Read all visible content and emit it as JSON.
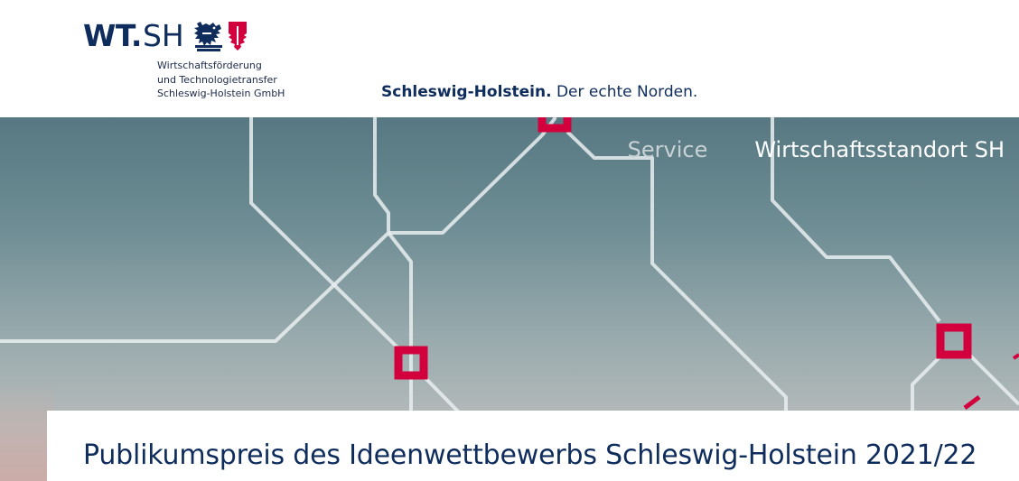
{
  "logo": {
    "wt": "WT.",
    "sh": "SH",
    "lion_icon": "lion-coat-of-arms-icon",
    "nettle_icon": "nettle-leaf-icon",
    "subtitle_lines": [
      "Wirtschaftsförderung",
      "und Technologietransfer",
      "Schleswig-Holstein GmbH"
    ]
  },
  "tagline": {
    "bold": "Schleswig-Holstein.",
    "rest": " Der echte Norden."
  },
  "nav": {
    "items": [
      {
        "label": "Service",
        "state": "inactive"
      },
      {
        "label": "Wirtschaftsstandort SH",
        "state": "active"
      }
    ]
  },
  "hero": {
    "background_icon": "network-lines-graphic"
  },
  "page": {
    "title": "Publikumspreis des Ideenwettbewerbs Schleswig-Holstein 2021/22"
  },
  "colors": {
    "brand_blue": "#0f2d5c",
    "accent_red": "#d2003c",
    "nav_inactive": "#c8d2d4",
    "nav_active": "#ffffff"
  }
}
